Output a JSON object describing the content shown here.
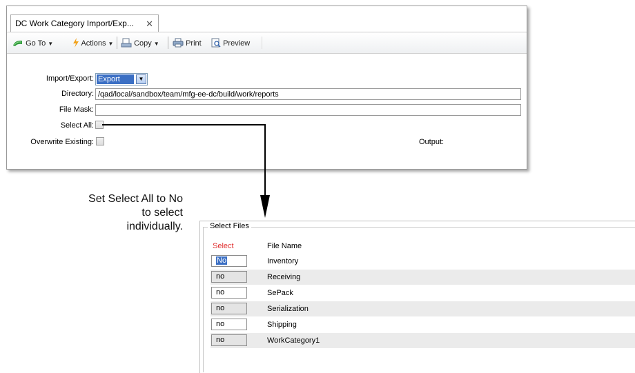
{
  "window": {
    "tab_title": "DC Work Category Import/Exp...",
    "tab_close": "✕"
  },
  "toolbar": {
    "goto_label": "Go To",
    "actions_label": "Actions",
    "copy_label": "Copy",
    "print_label": "Print",
    "preview_label": "Preview"
  },
  "form": {
    "import_export_label": "Import/Export:",
    "import_export_value": "Export",
    "directory_label": "Directory:",
    "directory_value": "/qad/local/sandbox/team/mfg-ee-dc/build/work/reports",
    "file_mask_label": "File Mask:",
    "file_mask_value": "",
    "select_all_label": "Select All:",
    "overwrite_label": "Overwrite Existing:",
    "output_label": "Output:"
  },
  "callout": {
    "line1": "Set Select All to No",
    "line2": "to select",
    "line3": "individually."
  },
  "select_files": {
    "group_title": "Select Files",
    "col_select": "Select",
    "col_file_name": "File Name",
    "select_header_color": "#e03030",
    "rows": [
      {
        "select": "No",
        "name": "Inventory"
      },
      {
        "select": "no",
        "name": "Receiving"
      },
      {
        "select": "no",
        "name": "SePack"
      },
      {
        "select": "no",
        "name": "Serialization"
      },
      {
        "select": "no",
        "name": "Shipping"
      },
      {
        "select": "no",
        "name": "WorkCategory1"
      }
    ]
  },
  "icons": {
    "goto": "go-to-icon",
    "actions": "actions-icon",
    "copy": "copy-icon",
    "print": "print-icon",
    "preview": "preview-icon"
  }
}
